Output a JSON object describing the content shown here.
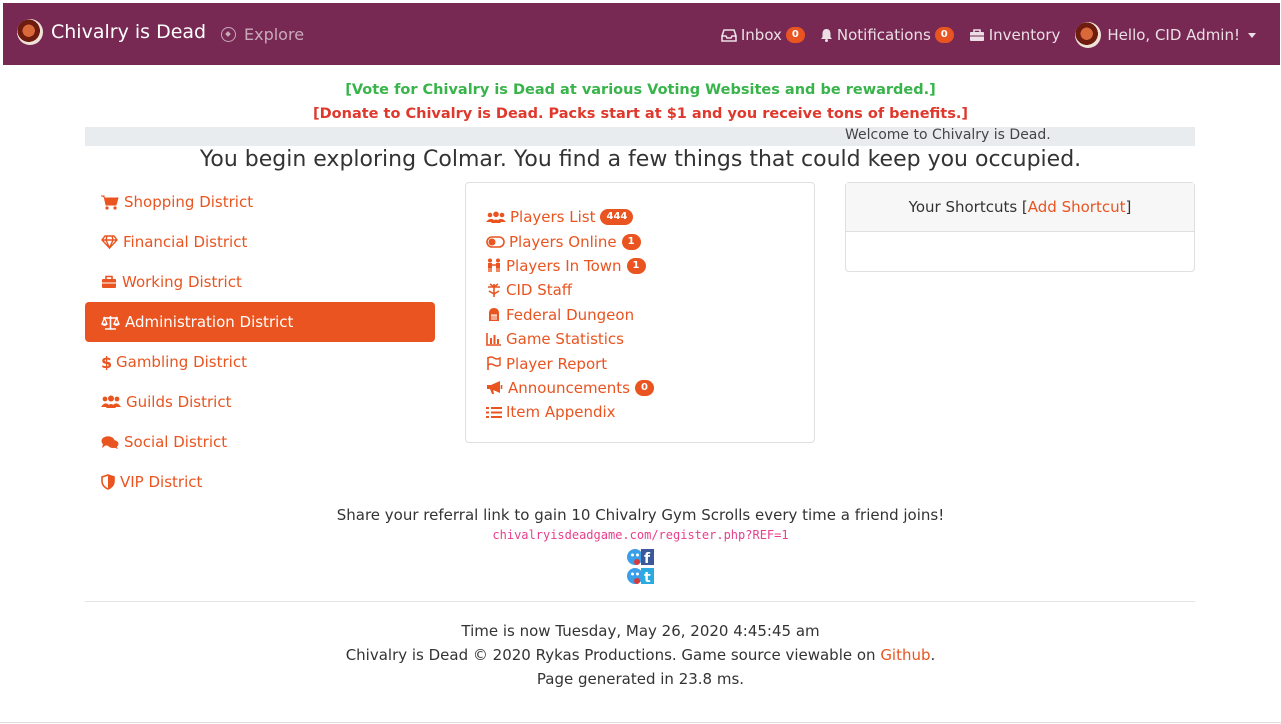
{
  "navbar": {
    "brand": "Chivalry is Dead",
    "explore": "Explore",
    "inbox_label": "Inbox",
    "inbox_count": "0",
    "notifications_label": "Notifications",
    "notifications_count": "0",
    "inventory_label": "Inventory",
    "user_greeting": "Hello, CID Admin!"
  },
  "announcements": {
    "vote": "[Vote for Chivalry is Dead at various Voting Websites and be rewarded.]",
    "donate": "[Donate to Chivalry is Dead. Packs start at $1 and you receive tons of benefits.]"
  },
  "welcome": "Welcome to Chivalry is Dead.",
  "headline": "You begin exploring Colmar. You find a few things that could keep you occupied.",
  "districts": [
    {
      "label": "Shopping District",
      "icon": "cart-icon"
    },
    {
      "label": "Financial District",
      "icon": "gem-icon"
    },
    {
      "label": "Working District",
      "icon": "briefcase-icon"
    },
    {
      "label": "Administration District",
      "icon": "balance-scale-icon",
      "active": true
    },
    {
      "label": "Gambling District",
      "icon": "dollar-icon"
    },
    {
      "label": "Guilds District",
      "icon": "users-icon"
    },
    {
      "label": "Social District",
      "icon": "comments-icon"
    },
    {
      "label": "VIP District",
      "icon": "shield-icon"
    }
  ],
  "admin_links": [
    {
      "label": "Players List",
      "badge": "444",
      "icon": "users-icon"
    },
    {
      "label": "Players Online",
      "badge": "1",
      "icon": "toggle-icon"
    },
    {
      "label": "Players In Town",
      "badge": "1",
      "icon": "people-icon"
    },
    {
      "label": "CID Staff",
      "icon": "staff-icon"
    },
    {
      "label": "Federal Dungeon",
      "icon": "dungeon-icon"
    },
    {
      "label": "Game Statistics",
      "icon": "chart-icon"
    },
    {
      "label": "Player Report",
      "icon": "flag-icon"
    },
    {
      "label": "Announcements",
      "badge": "0",
      "icon": "bullhorn-icon"
    },
    {
      "label": "Item Appendix",
      "icon": "list-icon"
    }
  ],
  "shortcuts": {
    "title_prefix": "Your Shortcuts [",
    "add_link": "Add Shortcut",
    "title_suffix": "]"
  },
  "referral": {
    "text": "Share your referral link to gain 10 Chivalry Gym Scrolls every time a friend joins!",
    "link": "chivalryisdeadgame.com/register.php?REF=1"
  },
  "footer": {
    "time_text": "Time is now Tuesday, May 26, 2020 4:45:45 am",
    "copyright_text": "Chivalry is Dead © 2020 Rykas Productions. Game source viewable on ",
    "github_link": "Github",
    "period": ".",
    "generated_text": "Page generated in 23.8 ms."
  },
  "colors": {
    "navbar": "#772953",
    "accent": "#e95420",
    "vote": "#38b44a",
    "donate": "#df382c"
  }
}
